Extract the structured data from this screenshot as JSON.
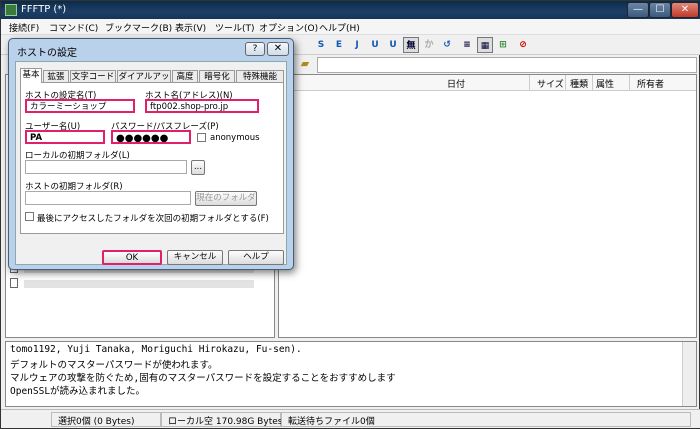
{
  "window": {
    "title": "FFFTP (*)",
    "min": "—",
    "max": "☐",
    "close": "✕"
  },
  "menu": [
    "接続(F)",
    "コマンド(C)",
    "ブックマーク(B)",
    "表示(V)",
    "ツール(T)",
    "オプション(O)",
    "ヘルプ(H)"
  ],
  "toolbar": [
    "S",
    "E",
    "J",
    "U",
    "U",
    "無",
    "か",
    "↺",
    "≡",
    "▦",
    "⊞",
    "⊘"
  ],
  "right_columns": [
    "日付",
    "サイズ",
    "種類",
    "属性",
    "所有者"
  ],
  "dialog": {
    "title": "ホストの設定",
    "help_btn": "?",
    "close_btn": "✕",
    "tabs": [
      "基本",
      "拡張",
      "文字コード",
      "ダイアルアップ",
      "高度",
      "暗号化",
      "特殊機能"
    ],
    "host_setting_name_label": "ホストの設定名(T)",
    "host_setting_name_value": "カラーミーショップ",
    "host_name_label": "ホスト名(アドレス)(N)",
    "host_name_value": "ftp002.shop-pro.jp",
    "user_name_label": "ユーザー名(U)",
    "user_name_value": "PA",
    "password_label": "パスワード/パスフレーズ(P)",
    "password_value": "●●●●●●",
    "anonymous_label": "anonymous",
    "local_folder_label": "ローカルの初期フォルダ(L)",
    "local_folder_value": "",
    "browse_btn": "...",
    "host_folder_label": "ホストの初期フォルダ(R)",
    "host_folder_value": "",
    "current_folder_btn": "現在のフォルダ",
    "last_folder_label": "最後にアクセスしたフォルダを次回の初期フォルダとする(F)",
    "ok": "OK",
    "cancel": "キャンセル",
    "help": "ヘルプ"
  },
  "log": [
    "tomo1192, Yuji Tanaka, Moriguchi Hirokazu, Fu-sen).",
    "デフォルトのマスターパスワードが使われます。",
    "マルウェアの攻撃を防ぐため,固有のマスターパスワードを設定することをおすすめします",
    "OpenSSLが読み込まれました。"
  ],
  "status": [
    "選択0個 (0 Bytes)",
    "ローカル空 170.98G Bytes",
    "転送待ちファイル0個"
  ]
}
